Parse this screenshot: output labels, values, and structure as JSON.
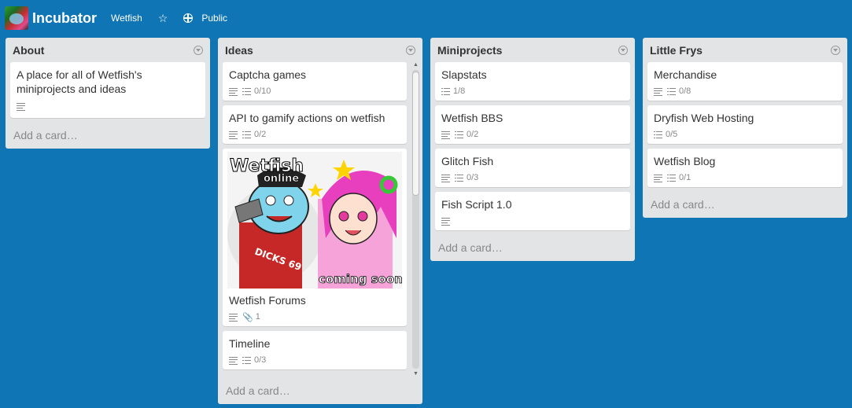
{
  "header": {
    "board_title": "Incubator",
    "org": "Wetfish",
    "star_icon": "star-icon",
    "visibility": "Public"
  },
  "lists": [
    {
      "title": "About",
      "cards": [
        {
          "title": "A place for all of Wetfish's miniprojects and ideas",
          "has_desc": true
        }
      ],
      "add_card": "Add a card…"
    },
    {
      "title": "Ideas",
      "cards": [
        {
          "title": "Captcha games",
          "has_desc": true,
          "checklist": "0/10"
        },
        {
          "title": "API to gamify actions on wetfish",
          "has_desc": true,
          "checklist": "0/2"
        },
        {
          "title": "Wetfish Forums",
          "has_desc": true,
          "attachments": "1",
          "cover": {
            "logo": "Wetfish",
            "sub": "online",
            "jersey": "DICKS 69",
            "tagline": "coming soon"
          }
        },
        {
          "title": "Timeline",
          "has_desc": true,
          "checklist": "0/3"
        }
      ],
      "add_card": "Add a card…"
    },
    {
      "title": "Miniprojects",
      "cards": [
        {
          "title": "Slapstats",
          "checklist": "1/8"
        },
        {
          "title": "Wetfish BBS",
          "has_desc": true,
          "checklist": "0/2"
        },
        {
          "title": "Glitch Fish",
          "has_desc": true,
          "checklist": "0/3"
        },
        {
          "title": "Fish Script 1.0",
          "has_desc": true
        }
      ],
      "add_card": "Add a card…"
    },
    {
      "title": "Little Frys",
      "cards": [
        {
          "title": "Merchandise",
          "has_desc": true,
          "checklist": "0/8"
        },
        {
          "title": "Dryfish Web Hosting",
          "checklist": "0/5"
        },
        {
          "title": "Wetfish Blog",
          "has_desc": true,
          "checklist": "0/1"
        }
      ],
      "add_card": "Add a card…"
    }
  ],
  "colors": {
    "background": "#0f75b4",
    "list_bg": "#e2e4e6",
    "card_bg": "#ffffff"
  }
}
